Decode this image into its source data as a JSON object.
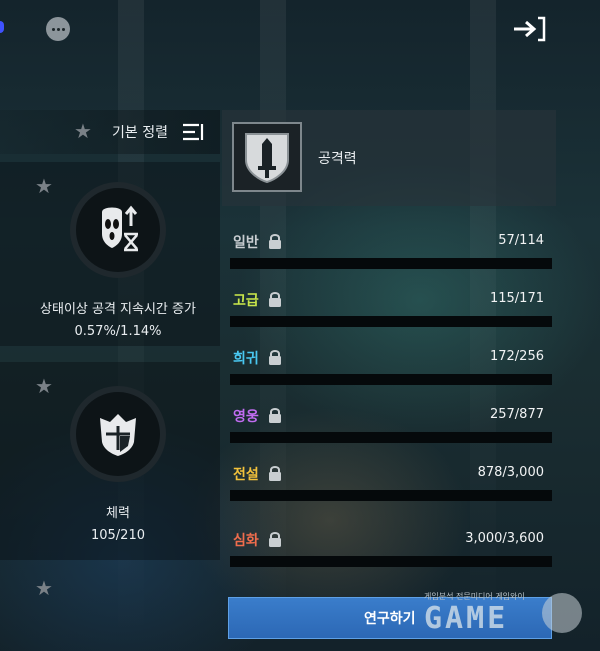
{
  "top_bar": {
    "more_icon": "more-dots-icon",
    "exit_icon": "exit-arrow-icon"
  },
  "left_panel": {
    "sort_label": "기본 정렬",
    "cards": [
      {
        "name": "상태이상 공격 지속시간 증가",
        "value": "0.57%/1.14%",
        "icon": "status-duration-icon"
      },
      {
        "name": "체력",
        "value": "105/210",
        "icon": "armor-shield-icon"
      }
    ]
  },
  "stat_panel": {
    "title": "공격력",
    "emblem_icon": "sword-shield-icon",
    "tiers": [
      {
        "name": "일반",
        "value": "57/114",
        "color": "#c8cdd1"
      },
      {
        "name": "고급",
        "value": "115/171",
        "color": "#c8e64a"
      },
      {
        "name": "희귀",
        "value": "172/256",
        "color": "#49c7f0"
      },
      {
        "name": "영웅",
        "value": "257/877",
        "color": "#c06cf0"
      },
      {
        "name": "전설",
        "value": "878/3,000",
        "color": "#f3c23b"
      },
      {
        "name": "심화",
        "value": "3,000/3,600",
        "color": "#f06d4d"
      }
    ]
  },
  "research_button": {
    "label": "연구하기"
  },
  "watermark": {
    "small_text": "게임분석 전문미디어 게임와이",
    "big_text": "GAME"
  }
}
